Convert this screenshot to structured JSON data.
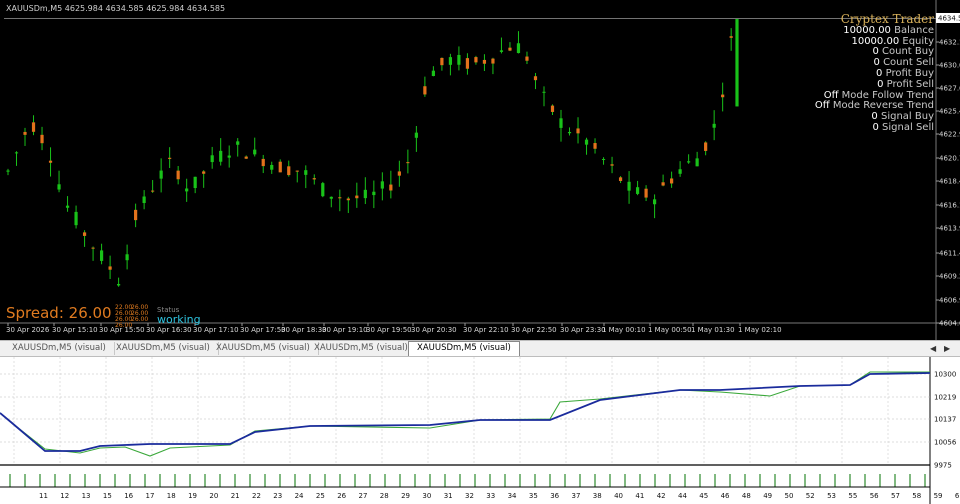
{
  "chart": {
    "title": "XAUUSDm,M5  4625.984 4634.585 4625.984 4634.585",
    "current_price": "4634.585",
    "price_ticks": [
      "4632.10",
      "4630.05",
      "4627.65",
      "4625.40",
      "4622.95",
      "4620.70",
      "4618.45",
      "4616.15",
      "4613.90",
      "4611.45",
      "4609.20",
      "4606.95",
      "4604.60"
    ],
    "time_ticks": [
      "30 Apr 2026",
      "30 Apr 15:10",
      "30 Apr 15:50",
      "30 Apr 16:30",
      "30 Apr 17:10",
      "30 Apr 17:50",
      "30 Apr 18:30",
      "30 Apr 19:10",
      "30 Apr 19:50",
      "30 Apr 20:30",
      "30 Apr 22:10",
      "30 Apr 22:50",
      "30 Apr 23:30",
      "1 May 00:10",
      "1 May 00:50",
      "1 May 01:30",
      "1 May 02:10"
    ],
    "colors": {
      "bull": "#19c219",
      "bear": "#e3721c",
      "background": "#000000",
      "grid": "#3c3c3c"
    }
  },
  "panel": {
    "brand": "Cryptex Trader",
    "rows": [
      {
        "value": "10000.00",
        "label": "Balance"
      },
      {
        "value": "10000.00",
        "label": "Equity"
      },
      {
        "value": "0",
        "label": "Count Buy"
      },
      {
        "value": "0",
        "label": "Count Sell"
      },
      {
        "value": "0",
        "label": "Profit Buy"
      },
      {
        "value": "0",
        "label": "Profit Sell"
      },
      {
        "value": "Off",
        "label": "Mode Follow Trend"
      },
      {
        "value": "Off",
        "label": "Mode Reverse Trend"
      },
      {
        "value": "0",
        "label": "Signal Buy"
      },
      {
        "value": "0",
        "label": "Signal Sell"
      }
    ]
  },
  "overlay": {
    "spread_label": "Spread: 26.00",
    "mini_left": [
      "22.00",
      "26.00",
      "26.00",
      "26.00"
    ],
    "mini_right": [
      "26.00",
      "26.00",
      "26.00"
    ],
    "status_label": "Status",
    "status_value": "working"
  },
  "tabs": [
    {
      "label": "XAUUSDm,M5 (visual)",
      "active": false
    },
    {
      "label": "XAUUSDm,M5 (visual)",
      "active": false
    },
    {
      "label": "XAUUSDm,M5 (visual)",
      "active": false
    },
    {
      "label": "XAUUSDm,M5 (visual)",
      "active": false
    },
    {
      "label": "XAUUSDm,M5 (visual)",
      "active": true
    }
  ],
  "equity": {
    "y_ticks": [
      "10300",
      "10219",
      "10137",
      "10056",
      "9975"
    ],
    "x_ticks": [
      "11",
      "12",
      "13",
      "15",
      "16",
      "17",
      "18",
      "19",
      "20",
      "21",
      "22",
      "23",
      "24",
      "25",
      "26",
      "27",
      "28",
      "29",
      "30",
      "31",
      "32",
      "33",
      "34",
      "35",
      "36",
      "37",
      "38",
      "40",
      "41",
      "42",
      "44",
      "45",
      "46",
      "48",
      "49",
      "50",
      "52",
      "53",
      "55",
      "56",
      "57",
      "58",
      "59",
      "61",
      "62"
    ],
    "colors": {
      "balance": "#1a2b9c",
      "equity": "#3aa83a",
      "volume": "#2d8a2d"
    }
  }
}
